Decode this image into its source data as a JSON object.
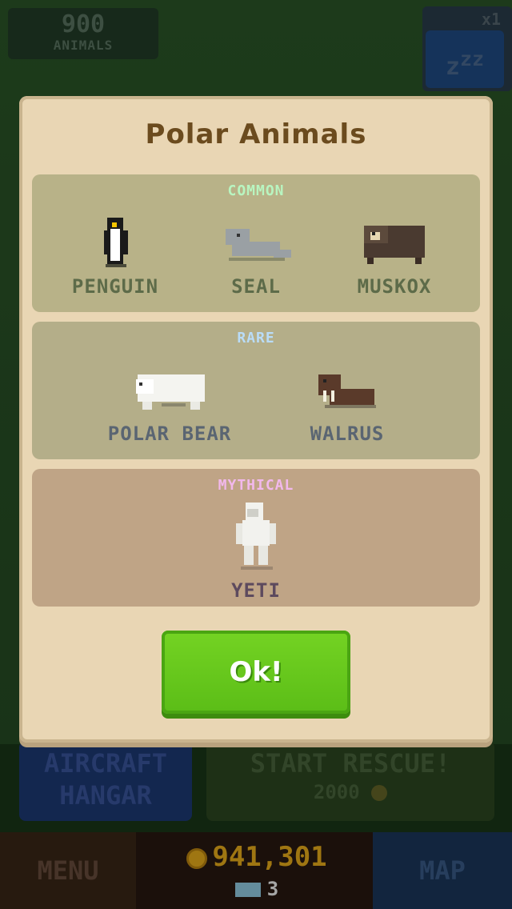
{
  "hud": {
    "animal_count": "900",
    "animal_count_label": "ANIMALS",
    "speed_multiplier": "x1",
    "speed_icon_label": "zzz"
  },
  "modal": {
    "title": "Polar Animals",
    "ok_label": "Ok!",
    "sections": [
      {
        "label": "COMMON",
        "label_color": "#b8f5c0",
        "animals": [
          "PENGUIN",
          "SEAL",
          "MUSKOX"
        ]
      },
      {
        "label": "RARE",
        "label_color": "#b9dcf8",
        "animals": [
          "POLAR BEAR",
          "WALRUS"
        ]
      },
      {
        "label": "MYTHICAL",
        "label_color": "#f2b8ec",
        "animals": [
          "YETI"
        ]
      }
    ]
  },
  "bottom": {
    "hangar_line1": "AIRCRAFT",
    "hangar_line2": "HANGAR",
    "rescue_title": "START RESCUE!",
    "rescue_cost": "2000",
    "menu": "MENU",
    "coins": "941,301",
    "gems": "3",
    "map": "MAP"
  }
}
